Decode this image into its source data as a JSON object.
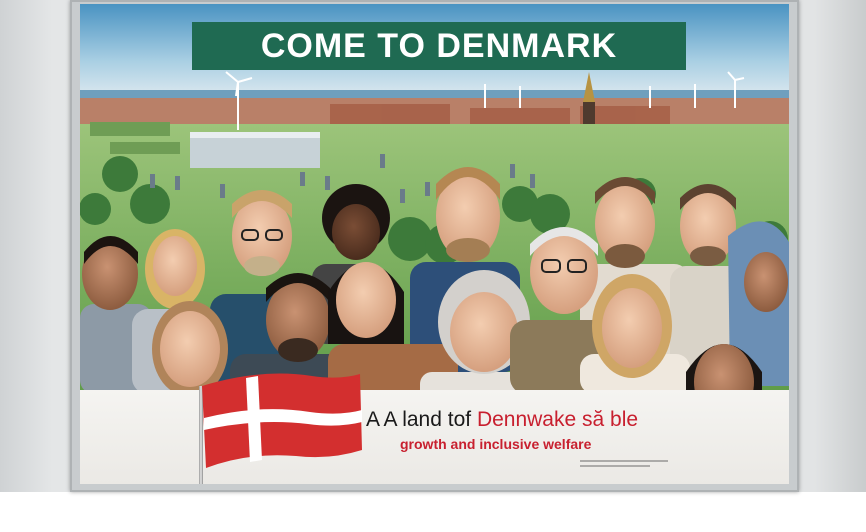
{
  "poster": {
    "headline": "COME TO DENMARK",
    "tagline_line1_prefix": "A A land tof ",
    "tagline_line1_highlight": "Dennwake să ble",
    "tagline_line2": "growth and inclusive welfare"
  },
  "colors": {
    "headline_bg": "#1f6a52",
    "accent_red": "#c8202f",
    "flag_red": "#d32f2f",
    "flag_cross": "#ffffff"
  }
}
